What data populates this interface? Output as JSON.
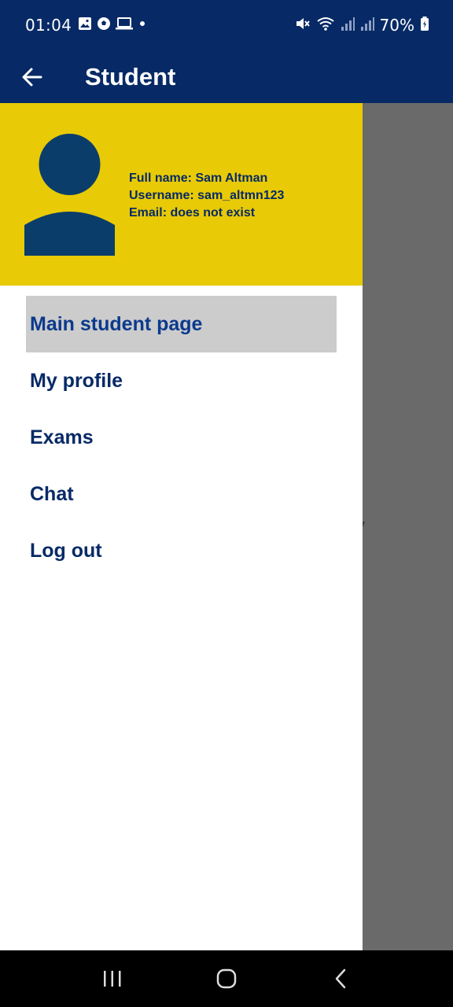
{
  "status_bar": {
    "time": "01:04",
    "battery": "70%",
    "icons_left": [
      "image-icon",
      "soccer-ball-icon",
      "laptop-icon",
      "dot-icon"
    ],
    "icons_right": [
      "mute-icon",
      "wifi-icon",
      "signal-icon",
      "signal-icon",
      "battery-icon"
    ]
  },
  "app_bar": {
    "title": "Student",
    "back_icon": "arrow-left-icon"
  },
  "drawer": {
    "user": {
      "full_name": "Full name: Sam Altman",
      "username": "Username: sam_altmn123",
      "email": "Email: does not exist"
    },
    "items": [
      {
        "label": "Main student page",
        "active": true
      },
      {
        "label": "My profile",
        "active": false
      },
      {
        "label": "Exams",
        "active": false
      },
      {
        "label": "Chat",
        "active": false
      },
      {
        "label": "Log out",
        "active": false
      }
    ]
  },
  "background": {
    "partial_text": "urely"
  },
  "colors": {
    "primary": "#072a66",
    "accent": "#e8ca06",
    "active_item_bg": "#cccccc",
    "scrim": "#6a6a6a"
  }
}
